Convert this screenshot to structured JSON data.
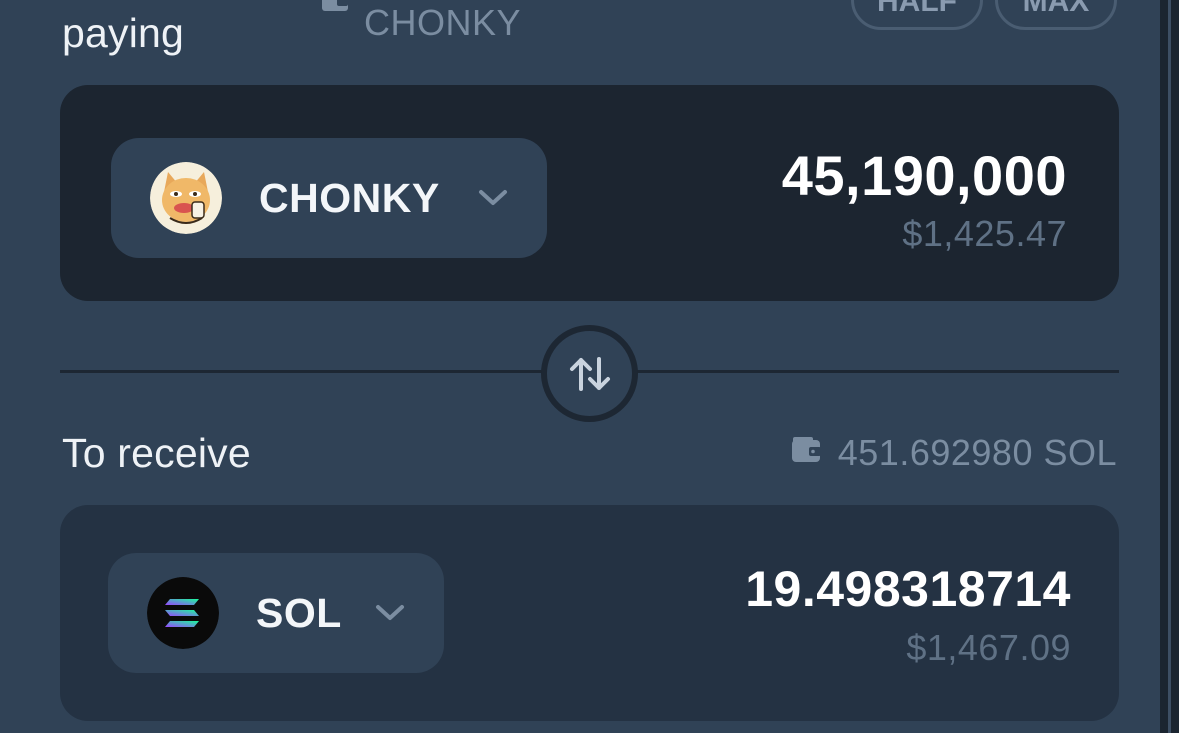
{
  "paying": {
    "label": "paying",
    "balance": "CHONKY",
    "half_label": "HALF",
    "max_label": "MAX",
    "token": {
      "symbol": "CHONKY",
      "icon": "chonky-token-logo"
    },
    "amount": "45,190,000",
    "usd_value": "$1,425.47"
  },
  "swap": {
    "icon": "swap-arrows-icon"
  },
  "receive": {
    "label": "To receive",
    "balance": "451.692980 SOL",
    "token": {
      "symbol": "SOL",
      "icon": "solana-token-logo"
    },
    "amount": "19.498318714",
    "usd_value": "$1,467.09"
  },
  "colors": {
    "background": "#304256",
    "pay_card": "#1c2530",
    "receive_card": "#243243",
    "muted_text": "#5f7185",
    "primary_text": "#ffffff"
  }
}
